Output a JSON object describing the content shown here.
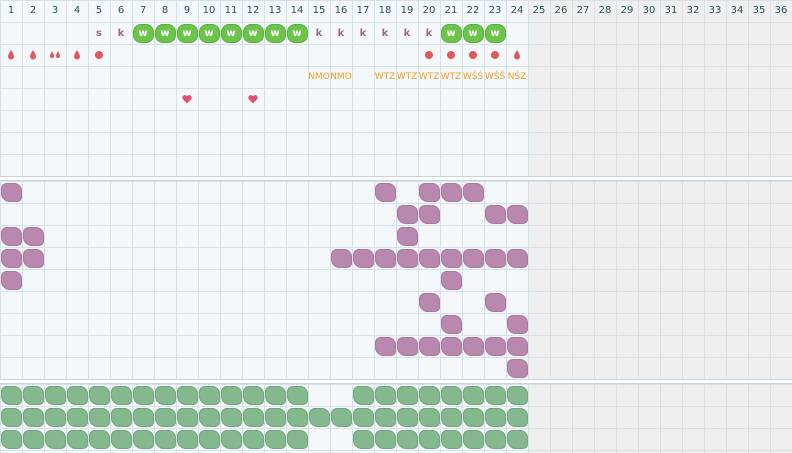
{
  "columns": [
    "1",
    "2",
    "3",
    "4",
    "5",
    "6",
    "7",
    "8",
    "9",
    "10",
    "11",
    "12",
    "13",
    "14",
    "15",
    "16",
    "17",
    "18",
    "19",
    "20",
    "21",
    "22",
    "23",
    "24",
    "25",
    "26",
    "27",
    "28",
    "29",
    "30",
    "31",
    "32",
    "33",
    "34",
    "35",
    "36"
  ],
  "active_columns": 24,
  "colors": {
    "active_bg": "#f4f8fb",
    "inactive_bg": "#efefef",
    "purple": "#b888ae",
    "green": "#86b890",
    "badge_green": "#6cc44a",
    "orange": "#f0a020",
    "red": "#e05a5a"
  },
  "legend_icons": {
    "drop": "drop-icon",
    "double_drop": "double-drop-icon",
    "dot": "dot-icon",
    "heart": "heart-icon",
    "purple_blob": "purple-blob-icon",
    "green_blob": "green-blob-icon"
  },
  "marks": [
    {
      "row": 0,
      "col": 5,
      "kind": "letter",
      "text": "s"
    },
    {
      "row": 0,
      "col": 6,
      "kind": "letter",
      "text": "k"
    },
    {
      "row": 0,
      "col": 7,
      "kind": "badge",
      "text": "w"
    },
    {
      "row": 0,
      "col": 8,
      "kind": "badge",
      "text": "w"
    },
    {
      "row": 0,
      "col": 9,
      "kind": "badge",
      "text": "w"
    },
    {
      "row": 0,
      "col": 10,
      "kind": "badge",
      "text": "w"
    },
    {
      "row": 0,
      "col": 11,
      "kind": "badge",
      "text": "w"
    },
    {
      "row": 0,
      "col": 12,
      "kind": "badge",
      "text": "w"
    },
    {
      "row": 0,
      "col": 13,
      "kind": "badge",
      "text": "w"
    },
    {
      "row": 0,
      "col": 14,
      "kind": "badge",
      "text": "w"
    },
    {
      "row": 0,
      "col": 15,
      "kind": "letter",
      "text": "k"
    },
    {
      "row": 0,
      "col": 16,
      "kind": "letter",
      "text": "k"
    },
    {
      "row": 0,
      "col": 17,
      "kind": "letter",
      "text": "k"
    },
    {
      "row": 0,
      "col": 18,
      "kind": "letter",
      "text": "k"
    },
    {
      "row": 0,
      "col": 19,
      "kind": "letter",
      "text": "k"
    },
    {
      "row": 0,
      "col": 20,
      "kind": "letter",
      "text": "k"
    },
    {
      "row": 0,
      "col": 21,
      "kind": "badge",
      "text": "w"
    },
    {
      "row": 0,
      "col": 22,
      "kind": "badge",
      "text": "w"
    },
    {
      "row": 0,
      "col": 23,
      "kind": "badge",
      "text": "w"
    },
    {
      "row": 1,
      "col": 1,
      "kind": "drop"
    },
    {
      "row": 1,
      "col": 2,
      "kind": "drop"
    },
    {
      "row": 1,
      "col": 3,
      "kind": "drop2"
    },
    {
      "row": 1,
      "col": 4,
      "kind": "drop"
    },
    {
      "row": 1,
      "col": 5,
      "kind": "dot"
    },
    {
      "row": 1,
      "col": 20,
      "kind": "dot"
    },
    {
      "row": 1,
      "col": 21,
      "kind": "dot"
    },
    {
      "row": 1,
      "col": 22,
      "kind": "dot"
    },
    {
      "row": 1,
      "col": 23,
      "kind": "dot"
    },
    {
      "row": 1,
      "col": 24,
      "kind": "drop"
    },
    {
      "row": 2,
      "col": 15,
      "kind": "orange",
      "text": "NMO"
    },
    {
      "row": 2,
      "col": 16,
      "kind": "orange",
      "text": "NMO"
    },
    {
      "row": 2,
      "col": 18,
      "kind": "orange",
      "text": "WTZ"
    },
    {
      "row": 2,
      "col": 19,
      "kind": "orange",
      "text": "WTZ"
    },
    {
      "row": 2,
      "col": 20,
      "kind": "orange",
      "text": "WTZ"
    },
    {
      "row": 2,
      "col": 21,
      "kind": "orange",
      "text": "WTZ"
    },
    {
      "row": 2,
      "col": 22,
      "kind": "orange",
      "text": "WŚŚ"
    },
    {
      "row": 2,
      "col": 23,
      "kind": "orange",
      "text": "WŚŚ"
    },
    {
      "row": 2,
      "col": 24,
      "kind": "orange",
      "text": "NŚZ"
    },
    {
      "row": 3,
      "col": 9,
      "kind": "heart"
    },
    {
      "row": 3,
      "col": 12,
      "kind": "heart"
    }
  ],
  "purple_cells": [
    [
      0,
      1
    ],
    [
      0,
      18
    ],
    [
      0,
      20
    ],
    [
      0,
      21
    ],
    [
      0,
      22
    ],
    [
      1,
      19
    ],
    [
      1,
      20
    ],
    [
      1,
      23
    ],
    [
      1,
      24
    ],
    [
      2,
      1
    ],
    [
      2,
      2
    ],
    [
      2,
      19
    ],
    [
      3,
      1
    ],
    [
      3,
      2
    ],
    [
      3,
      16
    ],
    [
      3,
      17
    ],
    [
      3,
      18
    ],
    [
      3,
      19
    ],
    [
      3,
      20
    ],
    [
      3,
      21
    ],
    [
      3,
      22
    ],
    [
      3,
      23
    ],
    [
      3,
      24
    ],
    [
      4,
      1
    ],
    [
      4,
      21
    ],
    [
      5,
      20
    ],
    [
      5,
      23
    ],
    [
      6,
      21
    ],
    [
      6,
      24
    ],
    [
      7,
      18
    ],
    [
      7,
      19
    ],
    [
      7,
      20
    ],
    [
      7,
      21
    ],
    [
      7,
      22
    ],
    [
      7,
      23
    ],
    [
      7,
      24
    ],
    [
      8,
      24
    ]
  ],
  "green_cells": [
    [
      0,
      1
    ],
    [
      0,
      2
    ],
    [
      0,
      3
    ],
    [
      0,
      4
    ],
    [
      0,
      5
    ],
    [
      0,
      6
    ],
    [
      0,
      7
    ],
    [
      0,
      8
    ],
    [
      0,
      9
    ],
    [
      0,
      10
    ],
    [
      0,
      11
    ],
    [
      0,
      12
    ],
    [
      0,
      13
    ],
    [
      0,
      14
    ],
    [
      0,
      17
    ],
    [
      0,
      18
    ],
    [
      0,
      19
    ],
    [
      0,
      20
    ],
    [
      0,
      21
    ],
    [
      0,
      22
    ],
    [
      0,
      23
    ],
    [
      0,
      24
    ],
    [
      1,
      1
    ],
    [
      1,
      2
    ],
    [
      1,
      3
    ],
    [
      1,
      4
    ],
    [
      1,
      5
    ],
    [
      1,
      6
    ],
    [
      1,
      7
    ],
    [
      1,
      8
    ],
    [
      1,
      9
    ],
    [
      1,
      10
    ],
    [
      1,
      11
    ],
    [
      1,
      12
    ],
    [
      1,
      13
    ],
    [
      1,
      14
    ],
    [
      1,
      15
    ],
    [
      1,
      16
    ],
    [
      1,
      17
    ],
    [
      1,
      18
    ],
    [
      1,
      19
    ],
    [
      1,
      20
    ],
    [
      1,
      21
    ],
    [
      1,
      22
    ],
    [
      1,
      23
    ],
    [
      1,
      24
    ],
    [
      2,
      1
    ],
    [
      2,
      2
    ],
    [
      2,
      3
    ],
    [
      2,
      4
    ],
    [
      2,
      5
    ],
    [
      2,
      6
    ],
    [
      2,
      7
    ],
    [
      2,
      8
    ],
    [
      2,
      9
    ],
    [
      2,
      10
    ],
    [
      2,
      11
    ],
    [
      2,
      12
    ],
    [
      2,
      13
    ],
    [
      2,
      14
    ],
    [
      2,
      17
    ],
    [
      2,
      18
    ],
    [
      2,
      19
    ],
    [
      2,
      20
    ],
    [
      2,
      21
    ],
    [
      2,
      22
    ],
    [
      2,
      23
    ],
    [
      2,
      24
    ]
  ]
}
